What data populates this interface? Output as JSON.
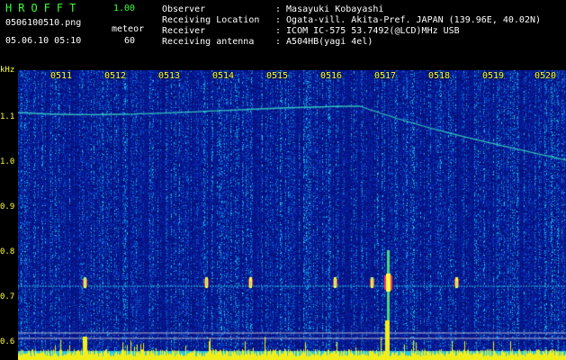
{
  "header": {
    "app_title": "HROFFT",
    "version": "1.00",
    "file_name": "0506100510.png",
    "mode": "meteor",
    "datetime": "05.06.10 05:10",
    "count": "60"
  },
  "info": {
    "observer_label": "Observer",
    "observer_value": ": Masayuki Kobayashi",
    "location_label": "Receiving Location",
    "location_value": ": Ogata-vill. Akita-Pref. JAPAN (139.96E, 40.02N)",
    "receiver_label": "Receiver",
    "receiver_value": ": ICOM IC-575 53.7492(@LCD)MHz USB",
    "antenna_label": "Receiving antenna",
    "antenna_value": ": A504HB(yagi 4el)"
  },
  "axes": {
    "y_unit": "kHz",
    "y_ticks": [
      "1.1",
      "1.0",
      "0.9",
      "0.8",
      "0.7",
      "0.6"
    ],
    "x_ticks": [
      "0511",
      "0512",
      "0513",
      "0514",
      "0515",
      "0516",
      "0517",
      "0518",
      "0519",
      "0520"
    ]
  },
  "colors": {
    "header_green": "#3cff3c",
    "label_yellow": "#ffff33",
    "background": "#000000",
    "spectrogram_base": "#0a1a9a"
  }
}
